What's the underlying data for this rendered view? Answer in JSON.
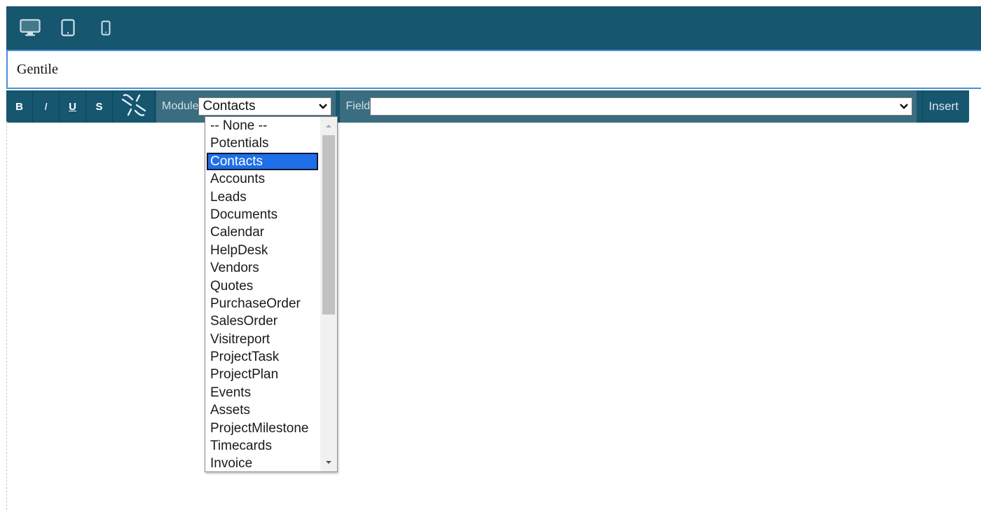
{
  "editor": {
    "text_content": "Gentile"
  },
  "device_bar": {
    "devices": [
      {
        "icon": "desktop-icon"
      },
      {
        "icon": "tablet-icon"
      },
      {
        "icon": "mobile-icon"
      }
    ]
  },
  "toolbar": {
    "bold_label": "B",
    "italic_label": "I",
    "underline_label": "U",
    "strike_label": "S",
    "link_icon": "unlink-icon",
    "module_label": "Module",
    "module_selected": "Contacts",
    "field_label": "Field",
    "field_selected": "",
    "insert_label": "Insert"
  },
  "module_dropdown": {
    "options": [
      "-- None --",
      "Potentials",
      "Contacts",
      "Accounts",
      "Leads",
      "Documents",
      "Calendar",
      "HelpDesk",
      "Vendors",
      "Quotes",
      "PurchaseOrder",
      "SalesOrder",
      "Visitreport",
      "ProjectTask",
      "ProjectPlan",
      "Events",
      "Assets",
      "ProjectMilestone",
      "Timecards",
      "Invoice"
    ],
    "selected_index": 2
  },
  "colors": {
    "toolbar_bg": "#16566f",
    "selection_bg": "#1e6fe8",
    "focus_border": "#4a90d9"
  }
}
